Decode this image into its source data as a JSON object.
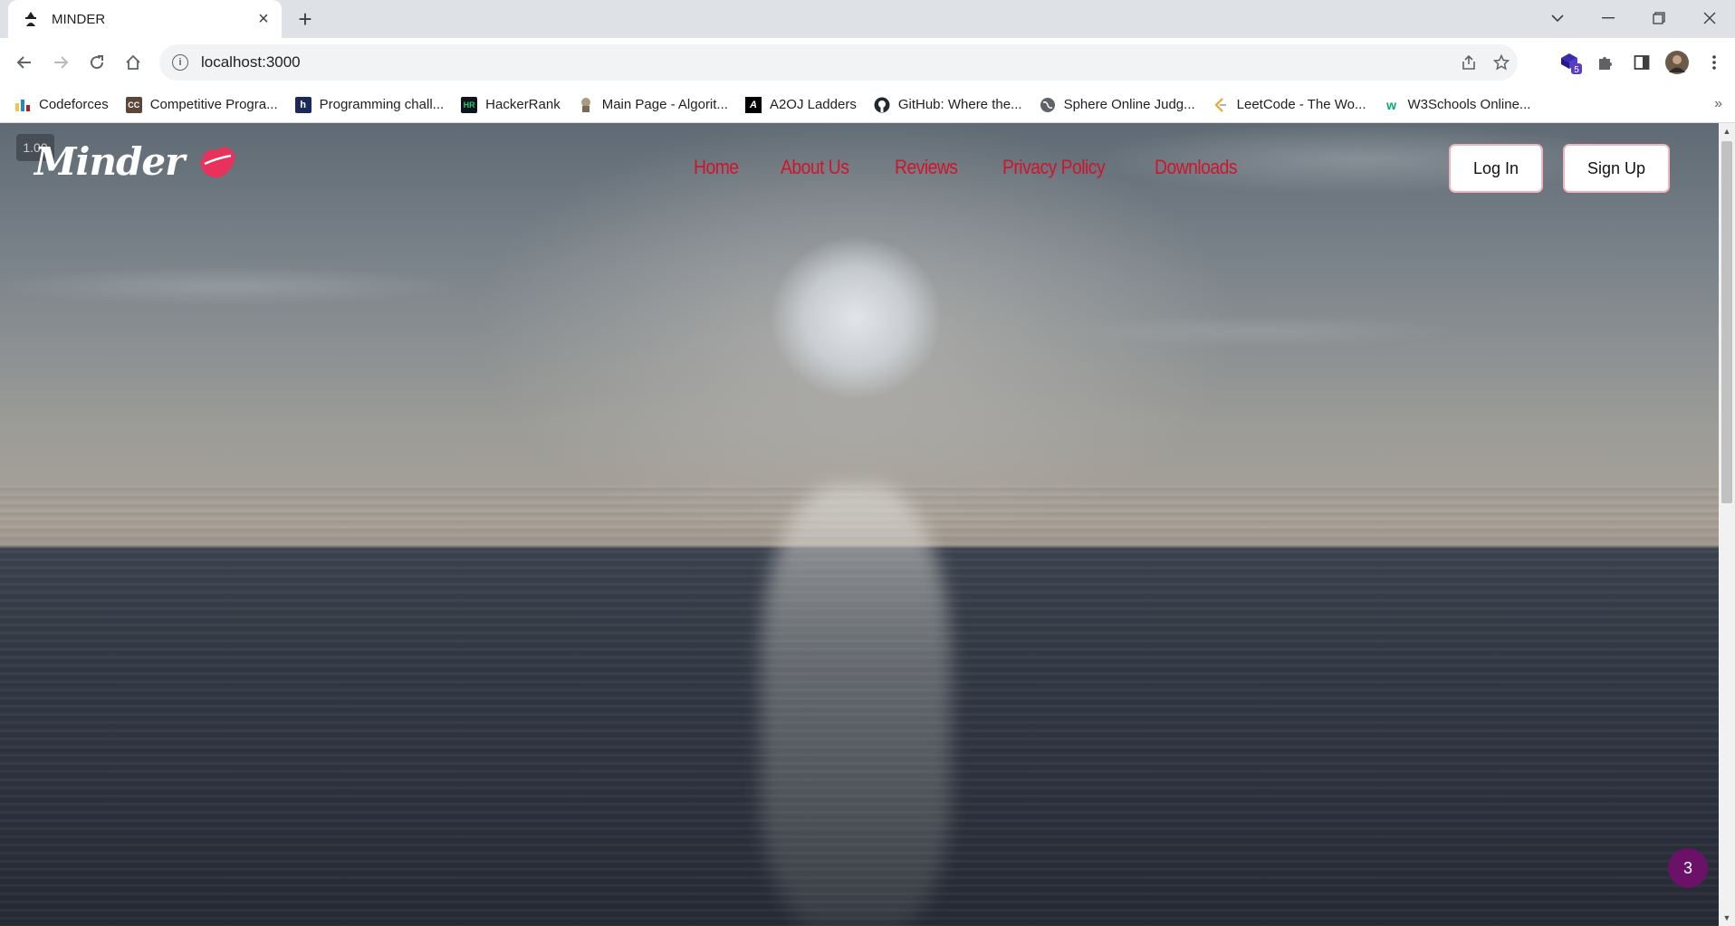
{
  "browser": {
    "tab": {
      "title": "MINDER",
      "favicon": "incognito-figure-icon"
    },
    "address": {
      "url": "localhost:3000"
    },
    "extensions_badge": "5",
    "bookmarks": [
      {
        "label": "Codeforces",
        "icon": "codeforces-icon",
        "color": "#1f8acb"
      },
      {
        "label": "Competitive Progra...",
        "icon": "cc-icon",
        "color": "#5b4638"
      },
      {
        "label": "Programming chall...",
        "icon": "h-icon",
        "color": "#1b2a59"
      },
      {
        "label": "HackerRank",
        "icon": "hackerrank-icon",
        "color": "#0e141e"
      },
      {
        "label": "Main Page - Algorit...",
        "icon": "algorithmist-icon",
        "color": "#7a6a52"
      },
      {
        "label": "A2OJ Ladders",
        "icon": "a2oj-icon",
        "color": "#000000"
      },
      {
        "label": "GitHub: Where the...",
        "icon": "github-icon",
        "color": "#24292e"
      },
      {
        "label": "Sphere Online Judg...",
        "icon": "globe-icon",
        "color": "#5f6368"
      },
      {
        "label": "LeetCode - The Wo...",
        "icon": "leetcode-icon",
        "color": "#f89f1b"
      },
      {
        "label": "W3Schools Online...",
        "icon": "w3schools-icon",
        "color": "#04aa6d"
      }
    ]
  },
  "page": {
    "speed": "1.00",
    "logo": {
      "text": "Minder",
      "accent": "#e8315b"
    },
    "nav": [
      "Home",
      "About Us",
      "Reviews",
      "Privacy Policy",
      "Downloads"
    ],
    "nav_color": "#d1142b",
    "login_label": "Log In",
    "signup_label": "Sign Up",
    "floating_badge": "3"
  }
}
